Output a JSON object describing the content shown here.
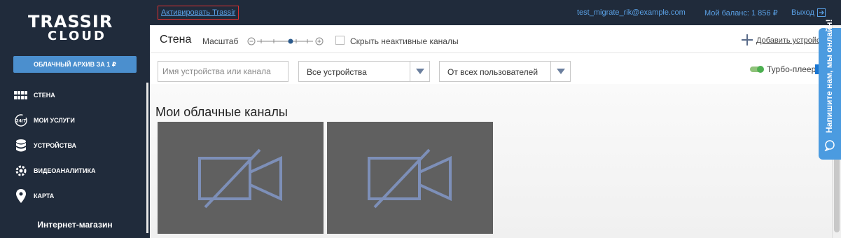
{
  "sidebar": {
    "logo_top": "TRASSIR",
    "logo_bottom": "CLOUD",
    "archive_button": "ОБЛАЧНЫЙ АРХИВ ЗА 1 ₽",
    "items": [
      {
        "label": "СТЕНА",
        "icon": "wall-icon"
      },
      {
        "label": "МОИ УСЛУГИ",
        "icon": "services-24-7-icon"
      },
      {
        "label": "УСТРОЙСТВА",
        "icon": "database-icon"
      },
      {
        "label": "ВИДЕОАНАЛИТИКА",
        "icon": "brain-gear-icon"
      },
      {
        "label": "КАРТА",
        "icon": "map-pin-icon"
      }
    ],
    "shop_link": "Интернет-магазин"
  },
  "topbar": {
    "activate_link": "Активировать Trassir",
    "user_email": "test_migrate_rik@example.com",
    "balance": "Мой баланс: 1 856 ₽",
    "logout": "Выход"
  },
  "toolbar": {
    "wall_title": "Стена",
    "scale_label": "Масштаб",
    "zoom_level": 0.6,
    "hide_inactive_label": "Скрыть неактивные каналы",
    "hide_inactive_checked": false,
    "add_device": "Добавить устройство"
  },
  "filters": {
    "search_placeholder": "Имя устройства или канала",
    "devices_select": "Все устройства",
    "users_select": "От всех пользователей",
    "turbo_label": "Турбо-плеер",
    "turbo_on": true
  },
  "content": {
    "section_title": "Мои облачные каналы",
    "tiles": [
      {
        "state": "no-signal",
        "icon": "camera-off-icon"
      },
      {
        "state": "no-signal",
        "icon": "camera-off-icon"
      }
    ]
  },
  "chat": {
    "label": "Напишите нам, мы онлайн!",
    "icon": "chat-bubble-icon"
  },
  "colors": {
    "sidebar_bg": "#202b3b",
    "accent": "#4b8fce",
    "link": "#5aa1e6",
    "tile_bg": "#606060",
    "icon_stroke": "#7d8fb8",
    "turbo_green": "#4caf50"
  }
}
